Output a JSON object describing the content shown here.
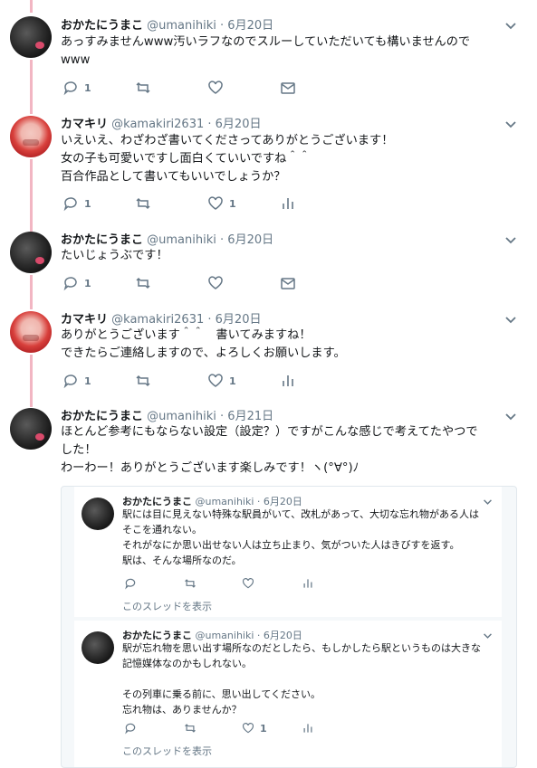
{
  "colors": {
    "accent": "#1da1f2",
    "thread_line": "#f2b6c3",
    "muted": "#657786"
  },
  "tweets": [
    {
      "name": "おかたにうまこ",
      "handle": "@umanihiki",
      "sep": "·",
      "date": "6月20日",
      "text": "あっすみませんwww汚いラフなのでスルーしていただいても構いませんので\nwww",
      "reply_count": "1",
      "like_count": "",
      "avatar": "okata-avatar",
      "extra_icon": "mail-icon"
    },
    {
      "name": "カマキリ",
      "handle": "@kamakiri2631",
      "sep": "·",
      "date": "6月20日",
      "text": "いえいえ、わざわざ書いてくださってありがとうございます！\n女の子も可愛いですし面白くていいですね＾＾\n百合作品として書いてもいいでしょうか？",
      "reply_count": "1",
      "like_count": "1",
      "avatar": "kama-avatar",
      "extra_icon": "analytics-icon"
    },
    {
      "name": "おかたにうまこ",
      "handle": "@umanihiki",
      "sep": "·",
      "date": "6月20日",
      "text": "たいじょうぶです！",
      "reply_count": "1",
      "like_count": "",
      "avatar": "okata-avatar",
      "extra_icon": "mail-icon"
    },
    {
      "name": "カマキリ",
      "handle": "@kamakiri2631",
      "sep": "·",
      "date": "6月20日",
      "text": "ありがとうございます＾＾　書いてみますね！\nできたらご連絡しますので、よろしくお願いします。",
      "reply_count": "1",
      "like_count": "1",
      "avatar": "kama-avatar",
      "extra_icon": "analytics-icon"
    },
    {
      "name": "おかたにうまこ",
      "handle": "@umanihiki",
      "sep": "·",
      "date": "6月21日",
      "text": "ほとんど参考にもならない設定（設定？）ですがこんな感じで考えてたやつで\nした！\nわーわー！ありがとうございます楽しみです！ヽ(°∀°)ﾉ",
      "reply_count": "",
      "like_count": "",
      "avatar": "okata-avatar",
      "extra_icon": ""
    }
  ],
  "embedded": [
    {
      "name": "おかたにうまこ",
      "handle": "@umanihiki",
      "sep": "·",
      "date": "6月20日",
      "text": "駅には目に見えない特殊な駅員がいて、改札があって、大切な忘れ物がある人は\nそこを通れない。\nそれがなにか思い出せない人は立ち止まり、気がついた人はきびすを返す。\n駅は、そんな場所なのだ。",
      "like_count": "",
      "show_thread": "このスレッドを表示"
    },
    {
      "name": "おかたにうまこ",
      "handle": "@umanihiki",
      "sep": "·",
      "date": "6月20日",
      "text": "駅が忘れ物を思い出す場所なのだとしたら、もしかしたら駅というものは大きな\n記憶媒体なのかもしれない。\n\nその列車に乗る前に、思い出してください。\n忘れ物は、ありませんか？",
      "like_count": "1",
      "show_thread": "このスレッドを表示"
    }
  ]
}
